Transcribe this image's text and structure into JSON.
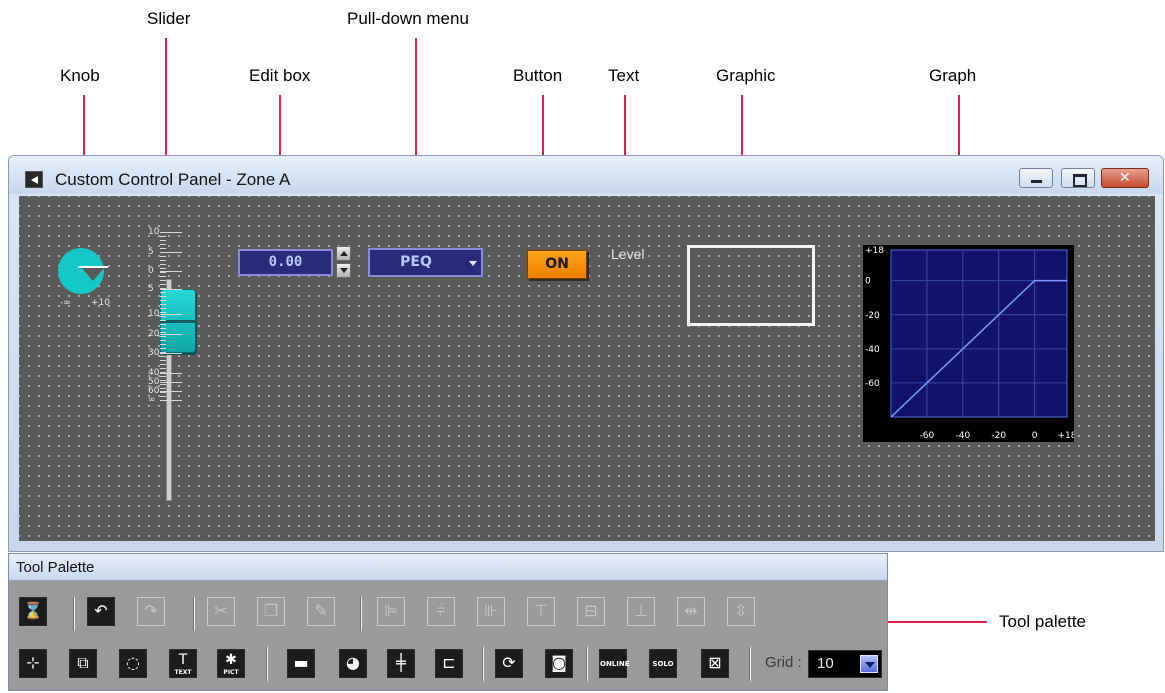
{
  "callouts": {
    "knob": "Knob",
    "slider": "Slider",
    "edit_box": "Edit box",
    "pulldown_menu": "Pull-down menu",
    "button": "Button",
    "text": "Text",
    "graphic": "Graphic",
    "graph": "Graph",
    "tool_palette": "Tool palette"
  },
  "window": {
    "title": "Custom Control Panel - Zone A",
    "icon": "panel-app-icon",
    "controls": [
      "minimize-icon",
      "maximize-icon",
      "close-icon"
    ]
  },
  "canvas": {
    "knob": {
      "min_label": "-∞",
      "max_label": "+10",
      "color": "#14c8c8"
    },
    "slider": {
      "scale_labels": [
        "10",
        "5",
        "0",
        "5",
        "10",
        "20",
        "30",
        "40",
        "50",
        "60",
        "∞"
      ],
      "color": "#14c8c8"
    },
    "edit_box": {
      "value": "0.00"
    },
    "pulldown": {
      "selected": "PEQ"
    },
    "button": {
      "label": "ON",
      "color": "#f28a00"
    },
    "text": {
      "label": "Level"
    },
    "graph": {
      "y_labels": [
        "+18",
        "0",
        "-20",
        "-40",
        "-60"
      ],
      "x_labels": [
        "-60",
        "-40",
        "-20",
        "0",
        "+18"
      ]
    }
  },
  "chart_data": {
    "type": "line",
    "title": "",
    "xlabel": "",
    "ylabel": "",
    "xlim": [
      -80,
      18
    ],
    "ylim": [
      -80,
      18
    ],
    "x_ticks": [
      "-60",
      "-40",
      "-20",
      "0",
      "+18"
    ],
    "y_ticks": [
      "+18",
      "0",
      "-20",
      "-40",
      "-60"
    ],
    "grid": true,
    "series": [
      {
        "x": [
          -80,
          0,
          18
        ],
        "y": [
          -80,
          0,
          0
        ]
      }
    ]
  },
  "tool_palette": {
    "title": "Tool Palette",
    "row1": [
      {
        "name": "hourglass-icon",
        "glyph": "⌛",
        "enabled": true
      },
      {
        "name": "undo-icon",
        "glyph": "↶",
        "enabled": true
      },
      {
        "name": "redo-icon",
        "glyph": "↷",
        "enabled": false
      },
      {
        "name": "cut-icon",
        "glyph": "✂",
        "enabled": false
      },
      {
        "name": "copy-icon",
        "glyph": "❐",
        "enabled": false
      },
      {
        "name": "paste-icon",
        "glyph": "✎",
        "enabled": false
      },
      {
        "name": "align-left-icon",
        "glyph": "⊫",
        "enabled": false
      },
      {
        "name": "align-center-icon",
        "glyph": "⫩",
        "enabled": false
      },
      {
        "name": "align-right-icon",
        "glyph": "⊪",
        "enabled": false
      },
      {
        "name": "align-top-icon",
        "glyph": "⊤",
        "enabled": false
      },
      {
        "name": "align-middle-icon",
        "glyph": "⊟",
        "enabled": false
      },
      {
        "name": "align-bottom-icon",
        "glyph": "⊥",
        "enabled": false
      },
      {
        "name": "space-horizontal-icon",
        "glyph": "⇹",
        "enabled": false
      },
      {
        "name": "space-vertical-icon",
        "glyph": "⇳",
        "enabled": false
      }
    ],
    "row2": [
      {
        "name": "link-icon",
        "glyph": "⊹",
        "enabled": true,
        "small": ""
      },
      {
        "name": "group-icon",
        "glyph": "⧉",
        "enabled": true,
        "small": ""
      },
      {
        "name": "lasso-icon",
        "glyph": "◌",
        "enabled": true,
        "small": ""
      },
      {
        "name": "text-tool-icon",
        "glyph": "T",
        "enabled": true,
        "small": "TEXT"
      },
      {
        "name": "picture-tool-icon",
        "glyph": "✱",
        "enabled": true,
        "small": "PICT"
      },
      {
        "name": "rectangle-tool-icon",
        "glyph": "▬",
        "enabled": true,
        "small": ""
      },
      {
        "name": "knob-tool-icon",
        "glyph": "◕",
        "enabled": true,
        "small": ""
      },
      {
        "name": "fader-tool-icon",
        "glyph": "╪",
        "enabled": true,
        "small": ""
      },
      {
        "name": "graph-tool-icon",
        "glyph": "⊏",
        "enabled": true,
        "small": ""
      },
      {
        "name": "snapshot-recall-icon",
        "glyph": "⟳",
        "enabled": true,
        "small": ""
      },
      {
        "name": "snapshot-store-icon",
        "glyph": "◙",
        "enabled": true,
        "small": ""
      },
      {
        "name": "online-button-icon",
        "glyph": "",
        "enabled": true,
        "small": "ONLINE"
      },
      {
        "name": "solo-button-icon",
        "glyph": "",
        "enabled": true,
        "small": "SOLO"
      },
      {
        "name": "close-box-icon",
        "glyph": "⊠",
        "enabled": true,
        "small": ""
      }
    ],
    "grid_label": "Grid :",
    "grid_value": "10"
  }
}
